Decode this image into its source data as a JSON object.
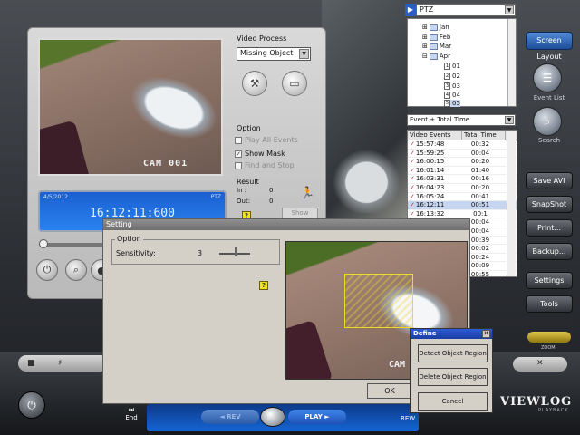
{
  "camera": {
    "label": "CAM 001"
  },
  "lcd": {
    "date": "4/5/2012",
    "ptz": "PTZ",
    "time": "16:12:11:600"
  },
  "video_process": {
    "title": "Video Process",
    "selected": "Missing Object",
    "option_title": "Option",
    "play_all_events": "Play All Events",
    "show_mask": "Show Mask",
    "find_and_stop": "Find and Stop",
    "result_title": "Result",
    "in_label": "In :",
    "in_value": "0",
    "out_label": "Out:",
    "out_value": "0",
    "show_button": "Show",
    "help": "?"
  },
  "tree": {
    "source": "PTZ",
    "items": [
      {
        "label": "Jan",
        "type": "folder"
      },
      {
        "label": "Feb",
        "type": "folder"
      },
      {
        "label": "Mar",
        "type": "folder"
      },
      {
        "label": "Apr",
        "type": "folder"
      },
      {
        "label": "01",
        "type": "day"
      },
      {
        "label": "02",
        "type": "day"
      },
      {
        "label": "03",
        "type": "day"
      },
      {
        "label": "04",
        "type": "day"
      },
      {
        "label": "05",
        "type": "day"
      }
    ]
  },
  "events": {
    "filter": "Event + Total Time",
    "columns": [
      "Video Events",
      "Total Time"
    ],
    "rows": [
      {
        "time": "15:57:48",
        "total": "00:32"
      },
      {
        "time": "15:59:25",
        "total": "00:04"
      },
      {
        "time": "16:00:15",
        "total": "00:20"
      },
      {
        "time": "16:01:14",
        "total": "01:40"
      },
      {
        "time": "16:03:31",
        "total": "00:16"
      },
      {
        "time": "16:04:23",
        "total": "00:20"
      },
      {
        "time": "16:05:24",
        "total": "00:41"
      },
      {
        "time": "16:12:11",
        "total": "00:51"
      },
      {
        "time": "16:13:32",
        "total": "00:1"
      },
      {
        "time": "",
        "total": "00:04"
      },
      {
        "time": "",
        "total": "00:04"
      },
      {
        "time": "",
        "total": "00:39"
      },
      {
        "time": "",
        "total": "00:02"
      },
      {
        "time": "",
        "total": "00:24"
      },
      {
        "time": "",
        "total": "00:09"
      },
      {
        "time": "",
        "total": "00:55"
      }
    ]
  },
  "side": {
    "screen_layout": "Screen Layout",
    "event_list": "Event List",
    "search": "Search",
    "save_avi": "Save AVI",
    "snapshot": "SnapShot",
    "print": "Print...",
    "backup": "Backup...",
    "settings": "Settings",
    "tools": "Tools",
    "zoom": "ZOOM"
  },
  "setting_dialog": {
    "title": "Setting",
    "option_title": "Option",
    "sensitivity_label": "Sensitivity:",
    "sensitivity_value": "3",
    "help": "?",
    "preview_label": "CAM",
    "ok": "OK"
  },
  "define_dialog": {
    "title": "Define",
    "close": "✕",
    "detect_button": "Detect Object Region",
    "delete_button": "Delete Object Region",
    "cancel_button": "Cancel"
  },
  "player": {
    "end": "End",
    "reverse": "◄ REV",
    "play": "PLAY ►",
    "rew": "REW",
    "logo": "VIEWLOG",
    "logo_sub": "PLAYBACK"
  },
  "colors": {
    "accent_blue": "#1b5fd1",
    "mask_yellow": "#f0d826",
    "event_check": "#b01616"
  }
}
